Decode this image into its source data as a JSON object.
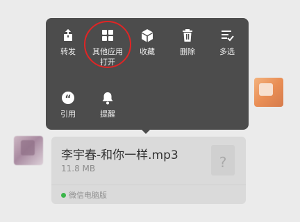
{
  "menu": {
    "items": [
      {
        "label": "转发",
        "icon": "share-out-icon"
      },
      {
        "label": "其他应用打开",
        "icon": "grid-apps-icon"
      },
      {
        "label": "收藏",
        "icon": "cube-icon"
      },
      {
        "label": "删除",
        "icon": "trash-icon"
      },
      {
        "label": "多选",
        "icon": "multi-select-icon"
      },
      {
        "label": "引用",
        "icon": "quote-icon"
      },
      {
        "label": "提醒",
        "icon": "bell-icon"
      }
    ],
    "highlight_color": "#e02525",
    "background": "#4c4c4c"
  },
  "file": {
    "name": "李宇春-和你一样.mp3",
    "size": "11.8 MB",
    "source": "微信电脑版",
    "type_icon": "?"
  }
}
